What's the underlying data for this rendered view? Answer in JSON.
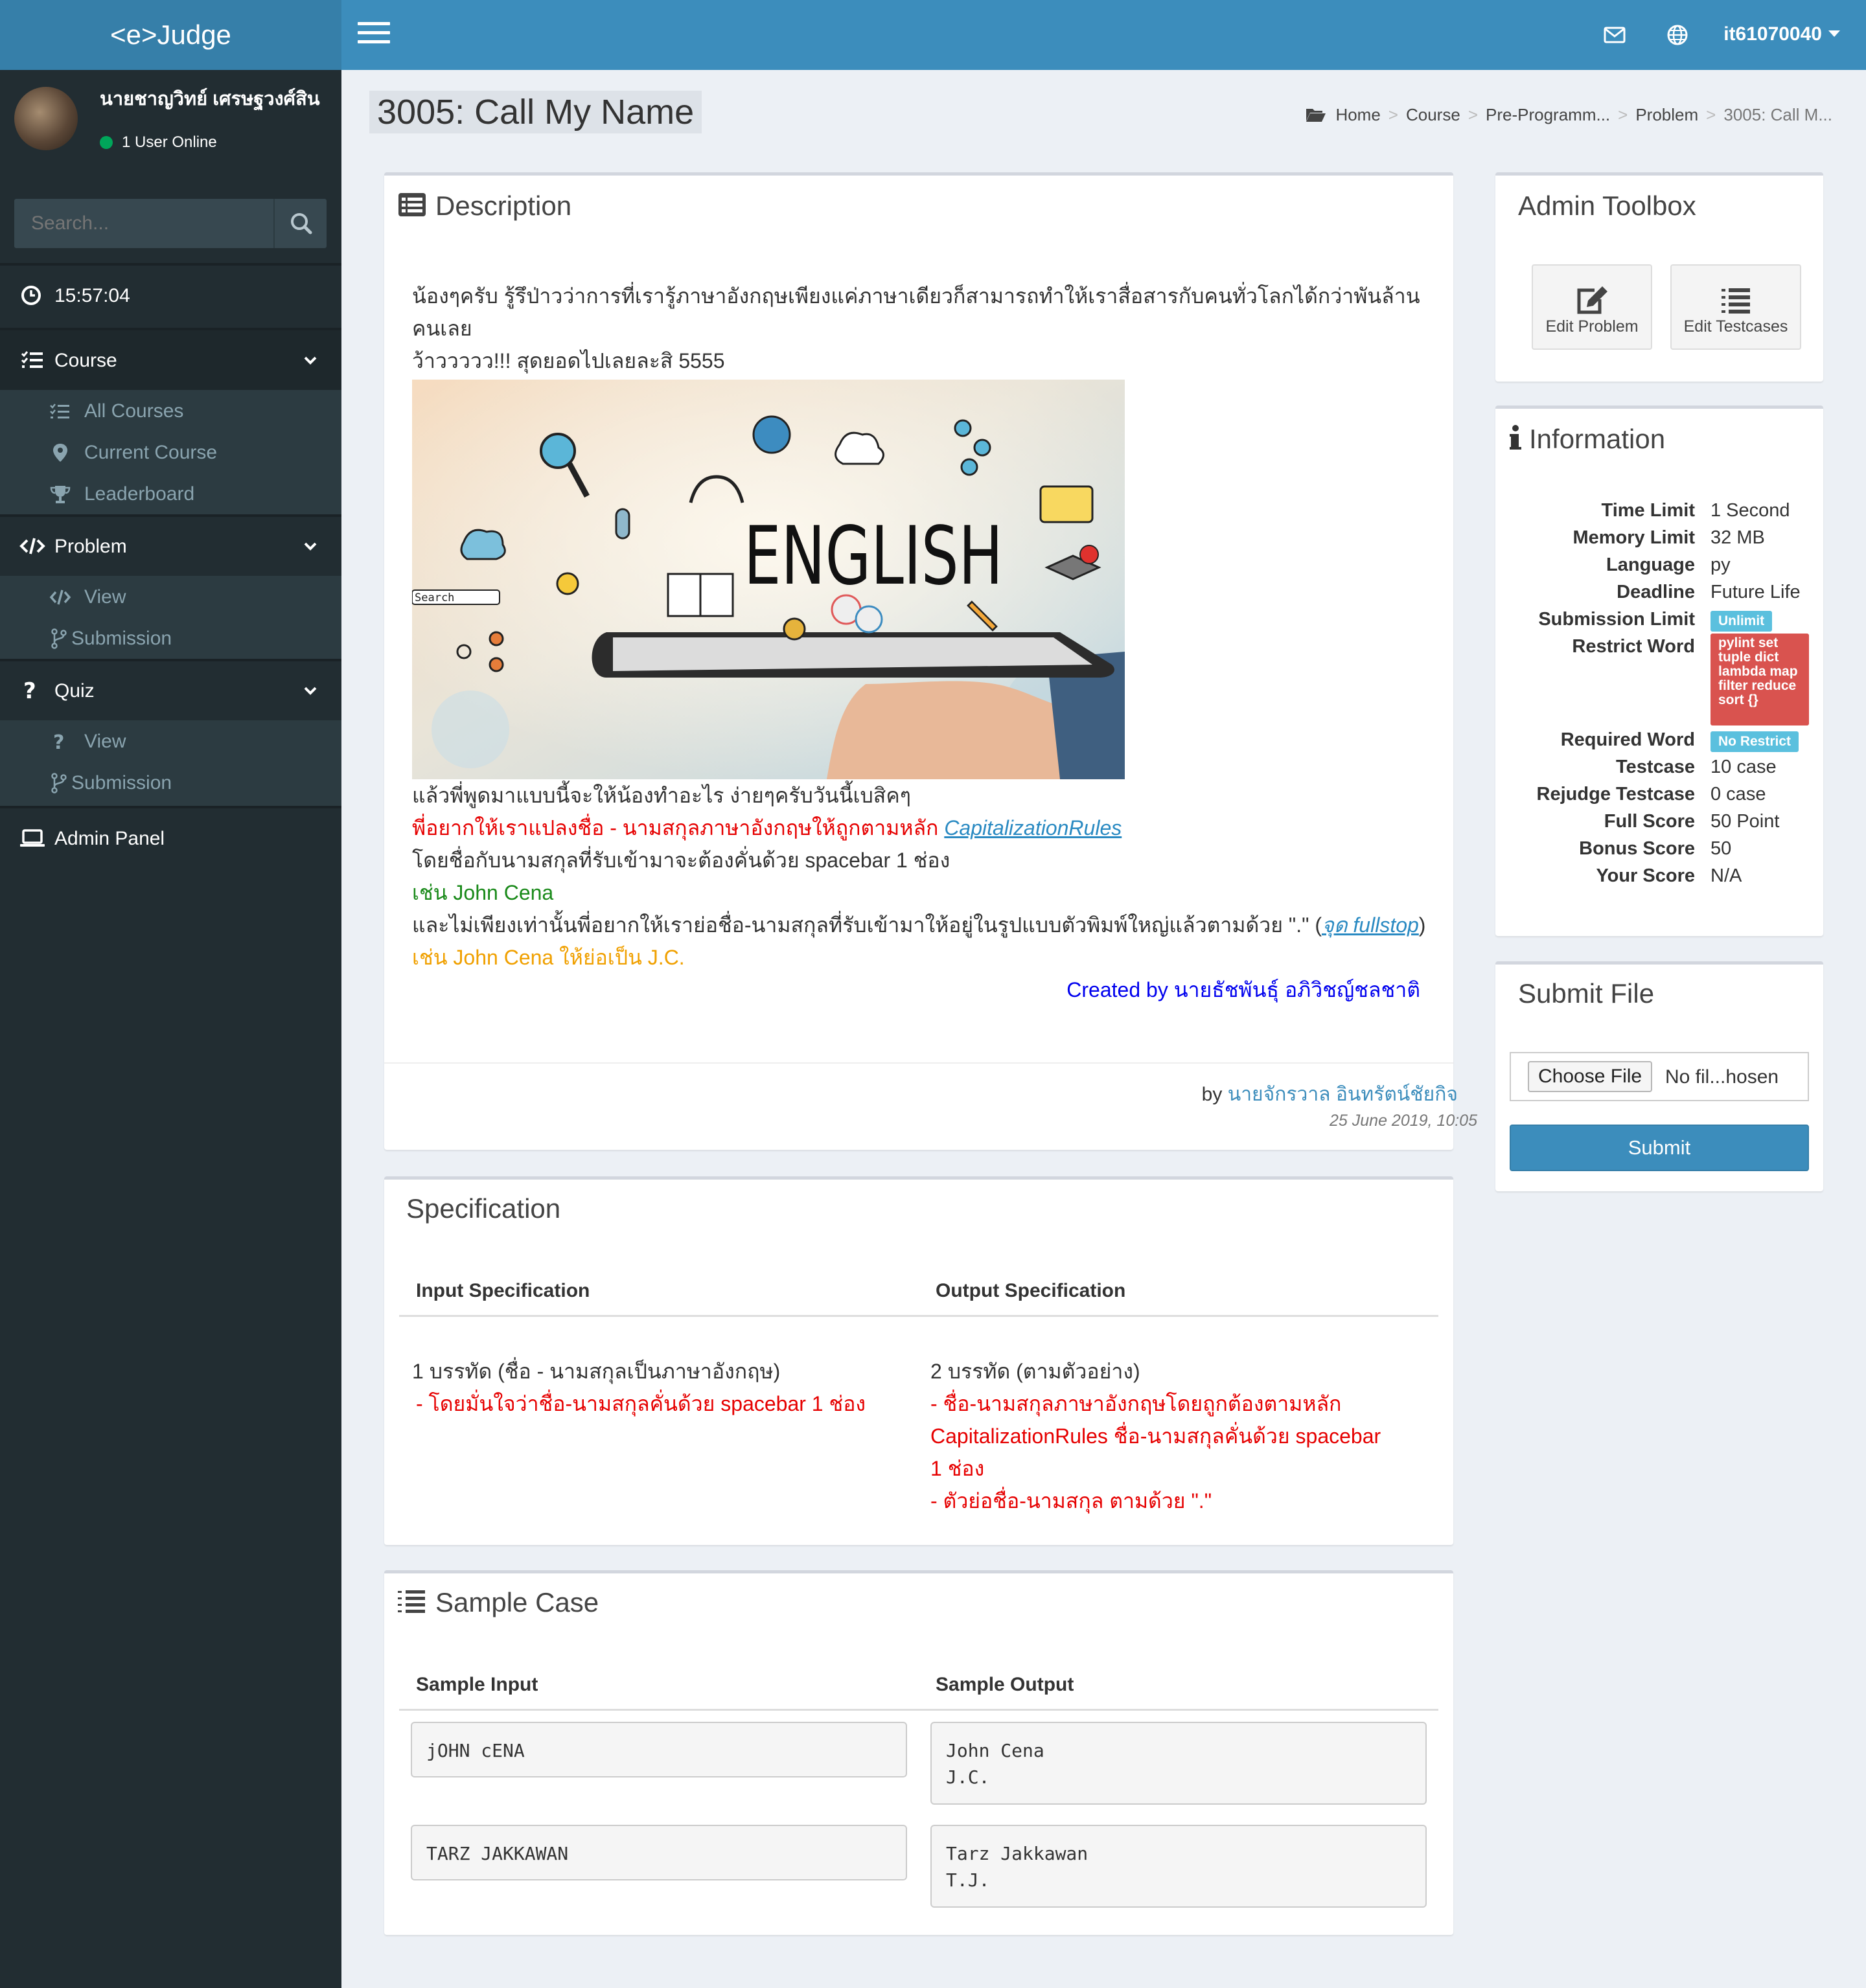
{
  "brand": "<e>Judge",
  "user": {
    "name": "นายชาญวิทย์ เศรษฐวงศ์สิน",
    "status": "1 User Online"
  },
  "search": {
    "placeholder": "Search..."
  },
  "clock": "15:57:04",
  "sidebar": {
    "course": {
      "label": "Course",
      "items": [
        "All Courses",
        "Current Course",
        "Leaderboard"
      ]
    },
    "problem": {
      "label": "Problem",
      "items": [
        "View",
        "Submission"
      ]
    },
    "quiz": {
      "label": "Quiz",
      "items": [
        "View",
        "Submission"
      ]
    },
    "admin_panel": "Admin Panel"
  },
  "topbar": {
    "username": "it61070040"
  },
  "page": {
    "title": "3005: Call My Name",
    "breadcrumb": [
      "Home",
      "Course",
      "Pre-Programm...",
      "Problem",
      "3005: Call M..."
    ]
  },
  "description": {
    "title": "Description",
    "intro1": "น้องๆครับ รู้รึป่าวว่าการที่เรารู้ภาษาอังกฤษเพียงแค่ภาษาเดียวก็สามารถทำให้เราสื่อสารกับคนทั่วโลกได้กว่าพันล้านคนเลย",
    "intro2": "ว้าววววว!!! สุดยอดไปเลยละสิ 5555",
    "image_words": {
      "main": "ENGLISH",
      "search": "Search"
    },
    "line1": "แล้วพี่พูดมาแบบนี้จะให้น้องทำอะไร ง่ายๆครับวันนี้เบสิคๆ",
    "line2_red": "พี่อยากให้เราแปลงชื่อ - นามสกุลภาษาอังกฤษให้ถูกตามหลัก ",
    "line2_link": "CapitalizationRules",
    "line3": "โดยชื่อกับนามสกุลที่รับเข้ามาจะต้องคั่นด้วย spacebar 1 ช่อง",
    "line4_green": "เช่น John Cena",
    "line5_before": "และไม่เพียงเท่านั้นพี่อยากให้เราย่อชื่อ-นามสกุลที่รับเข้ามาให้อยู่ในรูปแบบตัวพิมพ์ใหญ่แล้วตามด้วย \".\" (",
    "line5_link": "จุด fullstop",
    "line5_after": ")",
    "line6_orange": "เช่น John Cena ให้ย่อเป็น J.C.",
    "created_by": "Created by นายธัชพันธุ์ อภิวิชญ์ชลชาติ",
    "by_prefix": "by ",
    "author": "นายจักรวาล อินทรัตน์ชัยกิจ",
    "date": "25 June 2019, 10:05"
  },
  "specification": {
    "title": "Specification",
    "input_header": "Input Specification",
    "output_header": "Output Specification",
    "input_line1": "1 บรรทัด (ชื่อ - นามสกุลเป็นภาษาอังกฤษ)",
    "input_bullet": "-  โดยมั่นใจว่าชื่อ-นามสกุลคั่นด้วย spacebar 1 ช่อง",
    "output_line1": "2 บรรทัด (ตามตัวอย่าง)",
    "output_bullet1": "-  ชื่อ-นามสกุลภาษาอังกฤษโดยถูกต้องตามหลัก CapitalizationRules ชื่อ-นามสกุลคั่นด้วย spacebar 1 ช่อง",
    "output_bullet2": "-  ตัวย่อชื่อ-นามสกุล ตามด้วย \".\""
  },
  "sample_case": {
    "title": "Sample Case",
    "input_header": "Sample Input",
    "output_header": "Sample Output",
    "rows": [
      {
        "input": "jOHN cENA",
        "output": "John Cena\nJ.C."
      },
      {
        "input": "TARZ JAKKAWAN",
        "output": "Tarz Jakkawan\nT.J."
      }
    ]
  },
  "admin_toolbox": {
    "title": "Admin Toolbox",
    "edit_problem": "Edit Problem",
    "edit_testcases": "Edit Testcases"
  },
  "information": {
    "title": "Information",
    "time_limit": {
      "label": "Time Limit",
      "value": "1 Second"
    },
    "memory_limit": {
      "label": "Memory Limit",
      "value": "32 MB"
    },
    "language": {
      "label": "Language",
      "value": "py"
    },
    "deadline": {
      "label": "Deadline",
      "value": "Future Life"
    },
    "submission_limit": {
      "label": "Submission Limit",
      "value": "Unlimit"
    },
    "restrict_word": {
      "label": "Restrict Word",
      "value": "pylint set tuple dict lambda map filter reduce sort {}"
    },
    "required_word": {
      "label": "Required Word",
      "value": "No Restrict"
    },
    "testcase": {
      "label": "Testcase",
      "value": "10 case"
    },
    "rejudge_testcase": {
      "label": "Rejudge Testcase",
      "value": "0 case"
    },
    "full_score": {
      "label": "Full Score",
      "value": "50 Point"
    },
    "bonus_score": {
      "label": "Bonus Score",
      "value": "50"
    },
    "your_score": {
      "label": "Your Score",
      "value": "N/A"
    }
  },
  "submit_file": {
    "title": "Submit File",
    "choose_label": "Choose File",
    "no_file": "No fil...hosen",
    "submit_label": "Submit"
  },
  "colors": {
    "sidebar": "#222d32",
    "header": "#3c8dbc",
    "info_badge": "#5bc0de",
    "danger_badge": "#d9534f"
  }
}
